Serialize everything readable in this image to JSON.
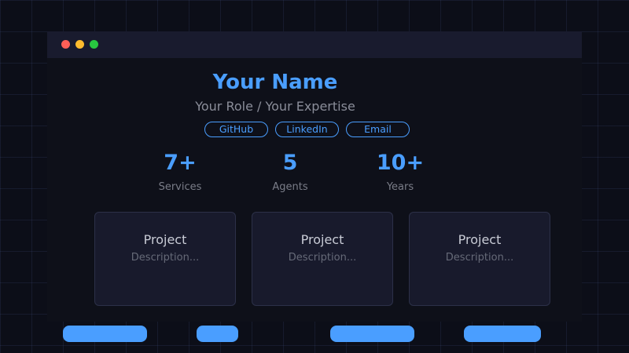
{
  "window": {
    "controls": [
      "close-dot",
      "minimize-dot",
      "maximize-dot"
    ]
  },
  "profile": {
    "name": "Your Name",
    "role": "Your Role / Your Expertise"
  },
  "links": [
    {
      "label": "GitHub"
    },
    {
      "label": "LinkedIn"
    },
    {
      "label": "Email"
    }
  ],
  "stats": [
    {
      "value": "7+",
      "label": "Services"
    },
    {
      "value": "5",
      "label": "Agents"
    },
    {
      "value": "10+",
      "label": "Years"
    }
  ],
  "projects": [
    {
      "title": "Project",
      "description": "Description..."
    },
    {
      "title": "Project",
      "description": "Description..."
    },
    {
      "title": "Project",
      "description": "Description..."
    }
  ],
  "colors": {
    "accent": "#4a9eff",
    "background": "#0c0e18",
    "titlebar": "#191b2e",
    "card": "#181a2c",
    "close": "#ff5f57",
    "minimize": "#febc2e",
    "maximize": "#28c840"
  }
}
